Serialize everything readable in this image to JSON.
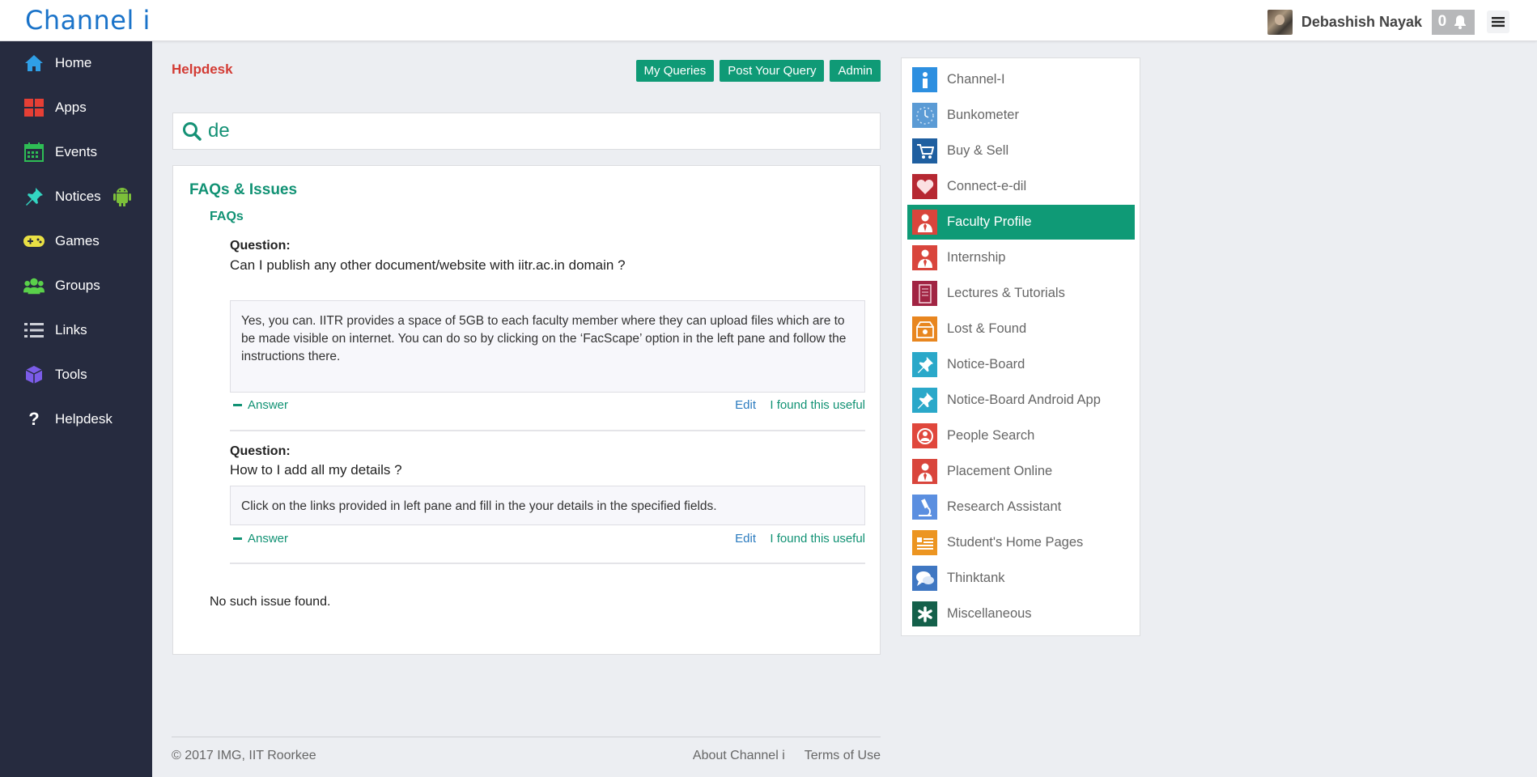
{
  "brand": "Channel i",
  "user": {
    "name": "Debashish Nayak",
    "notifications": "0"
  },
  "sidebar": {
    "items": [
      {
        "label": "Home",
        "icon": "home-icon",
        "color": "#2f9fe6"
      },
      {
        "label": "Apps",
        "icon": "apps-grid-icon",
        "color": "#e53f35"
      },
      {
        "label": "Events",
        "icon": "calendar-icon",
        "color": "#2ebd55"
      },
      {
        "label": "Notices",
        "icon": "pin-icon",
        "color": "#33d6c2"
      },
      {
        "label": "Games",
        "icon": "gamepad-icon",
        "color": "#e9e044"
      },
      {
        "label": "Groups",
        "icon": "group-icon",
        "color": "#5ad14a"
      },
      {
        "label": "Links",
        "icon": "list-icon",
        "color": "#cfd1d8"
      },
      {
        "label": "Tools",
        "icon": "cube-icon",
        "color": "#7b5ce8"
      },
      {
        "label": "Helpdesk",
        "icon": "question-icon",
        "color": "#ffffff"
      }
    ]
  },
  "main": {
    "title": "Helpdesk",
    "buttons": {
      "my_queries": "My Queries",
      "post_query": "Post Your Query",
      "admin": "Admin"
    },
    "search": {
      "value": "de"
    },
    "panel": {
      "heading": "FAQs & Issues",
      "subheading": "FAQs",
      "faqs": [
        {
          "question_label": "Question:",
          "question": "Can I publish any other document/website with iitr.ac.in domain ?",
          "answer": "Yes, you can. IITR provides a space of 5GB to each faculty member where they can upload files which are to be made visible on internet. You can do so by clicking on the ‘FacScape’ option in the left pane and follow the instructions there.",
          "answer_toggle": "Answer",
          "edit": "Edit",
          "useful": "I found this useful"
        },
        {
          "question_label": "Question:",
          "question": "How to I add all my details ?",
          "answer": "Click on the links provided in left pane and fill in the your details in the specified fields.",
          "answer_toggle": "Answer",
          "edit": "Edit",
          "useful": "I found this useful"
        }
      ],
      "no_issue": "No such issue found."
    }
  },
  "footer": {
    "copyright": "© 2017 IMG, IIT Roorkee",
    "about": "About Channel i",
    "terms": "Terms of Use"
  },
  "apps": [
    {
      "label": "Channel-I",
      "icon": "channel-i-icon",
      "color": "#2d8fe0"
    },
    {
      "label": "Bunkometer",
      "icon": "clock-icon",
      "color": "#5b9bd5"
    },
    {
      "label": "Buy & Sell",
      "icon": "cart-icon",
      "color": "#1f5fa0"
    },
    {
      "label": "Connect-e-dil",
      "icon": "heart-icon",
      "color": "#b62832"
    },
    {
      "label": "Faculty Profile",
      "icon": "person-tie-icon",
      "color": "#d9453c",
      "active": true
    },
    {
      "label": "Internship",
      "icon": "person-tie-icon",
      "color": "#d9453c"
    },
    {
      "label": "Lectures & Tutorials",
      "icon": "book-icon",
      "color": "#a12443"
    },
    {
      "label": "Lost & Found",
      "icon": "box-icon",
      "color": "#e8861f"
    },
    {
      "label": "Notice-Board",
      "icon": "pin-icon",
      "color": "#2aa8c9"
    },
    {
      "label": "Notice-Board Android App",
      "icon": "pin-icon",
      "color": "#2aa8c9"
    },
    {
      "label": "People Search",
      "icon": "person-search-icon",
      "color": "#e0473c"
    },
    {
      "label": "Placement Online",
      "icon": "person-tie-icon",
      "color": "#d9453c"
    },
    {
      "label": "Research Assistant",
      "icon": "microscope-icon",
      "color": "#5b8fe0"
    },
    {
      "label": "Student's Home Pages",
      "icon": "id-card-icon",
      "color": "#ec9521"
    },
    {
      "label": "Thinktank",
      "icon": "chat-icon",
      "color": "#3f77c2"
    },
    {
      "label": "Miscellaneous",
      "icon": "asterisk-icon",
      "color": "#14604a"
    }
  ]
}
